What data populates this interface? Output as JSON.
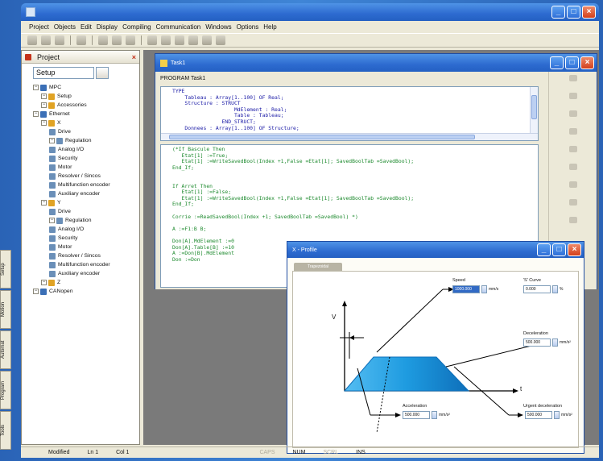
{
  "app": {
    "title": ""
  },
  "menu": [
    "Project",
    "Objects",
    "Edit",
    "Display",
    "Compiling",
    "Communication",
    "Windows",
    "Options",
    "Help"
  ],
  "project_panel": {
    "title": "Project",
    "combo_value": "Setup",
    "tree": [
      {
        "label": "MPC",
        "level": 1
      },
      {
        "label": "Setup",
        "level": 2
      },
      {
        "label": "Accessories",
        "level": 2
      },
      {
        "label": "Ethernet",
        "level": 1
      },
      {
        "label": "X",
        "level": 2
      },
      {
        "label": "Drive",
        "level": 3
      },
      {
        "label": "Regulation",
        "level": 3
      },
      {
        "label": "Analog I/O",
        "level": 3
      },
      {
        "label": "Security",
        "level": 3
      },
      {
        "label": "Motor",
        "level": 3
      },
      {
        "label": "Resolver / Sincos",
        "level": 3
      },
      {
        "label": "Multifunction encoder",
        "level": 3
      },
      {
        "label": "Auxiliary encoder",
        "level": 3
      },
      {
        "label": "Y",
        "level": 2
      },
      {
        "label": "Drive",
        "level": 3
      },
      {
        "label": "Regulation",
        "level": 3
      },
      {
        "label": "Analog I/O",
        "level": 3
      },
      {
        "label": "Security",
        "level": 3
      },
      {
        "label": "Motor",
        "level": 3
      },
      {
        "label": "Resolver / Sincos",
        "level": 3
      },
      {
        "label": "Multifunction encoder",
        "level": 3
      },
      {
        "label": "Auxiliary encoder",
        "level": 3
      },
      {
        "label": "Z",
        "level": 2
      },
      {
        "label": "CANopen",
        "level": 1
      }
    ],
    "side_tabs": [
      "Setup",
      "Motion",
      "Automat",
      "Program",
      "Tools"
    ]
  },
  "task_window": {
    "title": "Task1",
    "program_label": "PROGRAM Task1",
    "decl_code": "TYPE\n    Tableau : Array[1..100] OF Real;\n    Structure : STRUCT\n                    MdElement : Real;\n                    Table : Tableau;\n                END_STRUCT;\n    Donnees : Array[1..100] OF Structure;",
    "body_code": "(*If Bascule Then\n   Etat[1] :=True;\n   Etat[1] :=WriteSavedBool(Index +1,False =Etat[1]; SavedBoolTab =SavedBool);\nEnd_If;\n\n\nIf Arret Then\n   Etat[1] :=False;\n   Etat[1] :=WriteSavedBool(Index +1,False =Etat[1]; SavedBoolTab =SavedBool);\nEnd_If;\n\nCorrie :=ReadSavedBool(Index +1; SavedBoolTab =SavedBool) *)\n\nA :=F1:B B;\n\nDon[A].MdElement :=0\nDon[A].Table[B] :=10\nA :=Don[B].MdElement\nDon :=Don"
  },
  "profile_window": {
    "title": "X - Profile",
    "tab_label": "Trapezoidal",
    "speed_label": "Speed",
    "speed_value": "1000.000",
    "speed_unit": "mm/s",
    "scurve_label": "'S' Curve",
    "scurve_value": "0.000",
    "scurve_unit": "%",
    "deceleration_label": "Deceleration",
    "deceleration_value": "500.000",
    "deceleration_unit": "mm/s²",
    "acceleration_label": "Acceleration",
    "acceleration_value": "500.000",
    "acceleration_unit": "mm/s²",
    "urgent_label": "Urgent deceleration",
    "urgent_value": "500.000",
    "urgent_unit": "mm/s²",
    "axis_v": "V",
    "axis_t": "t"
  },
  "status": {
    "state": "Modified",
    "line": "Ln 1",
    "col": "Col 1",
    "caps": "CAPS",
    "num": "NUM",
    "scrl": "SCRL",
    "ins": "INS"
  },
  "colors": {
    "titlebar": "#2d6bd0",
    "frame": "#3a78c8",
    "profile_fill": "#1e9be0"
  }
}
